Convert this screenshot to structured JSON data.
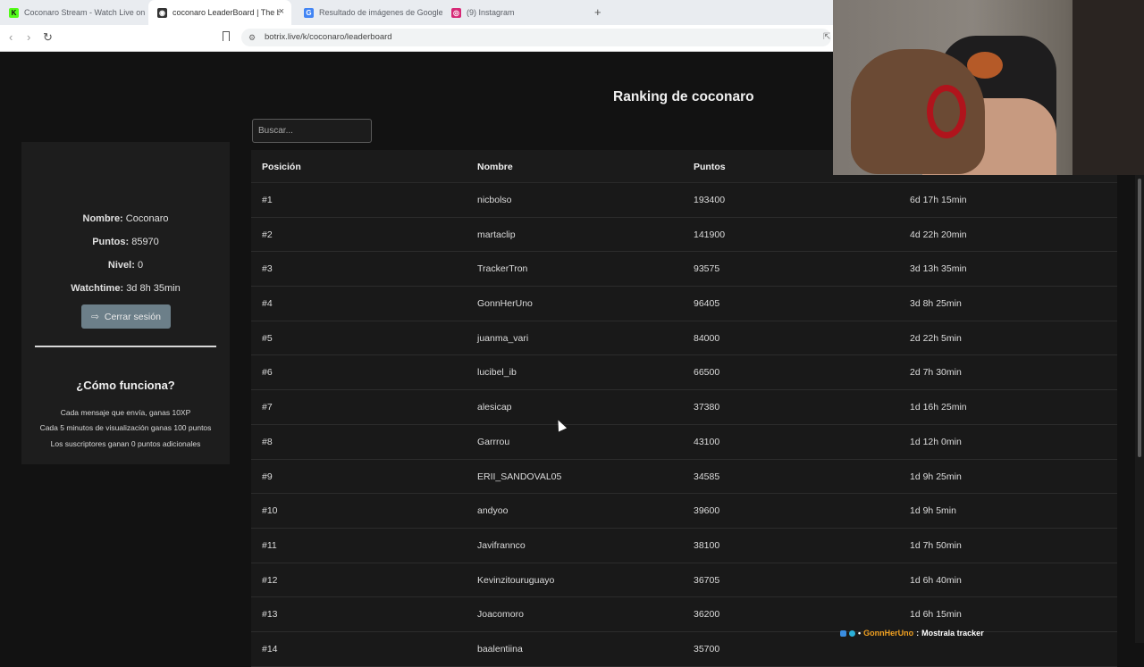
{
  "browser": {
    "tabs": [
      {
        "title": "Coconaro Stream - Watch Live on Ki",
        "favicon_color": "#53fc18",
        "favicon_glyph": "K"
      },
      {
        "title": "coconaro LeaderBoard | The bes",
        "favicon_color": "#333333",
        "favicon_glyph": "◉",
        "close": "×"
      },
      {
        "title": "Resultado de imágenes de Google",
        "favicon_color": "#4285f4",
        "favicon_glyph": "G"
      },
      {
        "title": "(9) Instagram",
        "favicon_color": "#d62976",
        "favicon_glyph": "◎"
      }
    ],
    "new_tab": "+",
    "url": "botrix.live/k/coconaro/leaderboard"
  },
  "page": {
    "title": "Ranking de coconaro",
    "search_placeholder": "Buscar..."
  },
  "profile": {
    "name_label": "Nombre:",
    "name_value": "Coconaro",
    "points_label": "Puntos:",
    "points_value": "85970",
    "level_label": "Nivel:",
    "level_value": "0",
    "watchtime_label": "Watchtime:",
    "watchtime_value": "3d 8h 35min",
    "logout_label": "Cerrar sesión"
  },
  "how": {
    "title": "¿Cómo funciona?",
    "lines": [
      "Cada mensaje que envía, ganas 10XP",
      "Cada 5 minutos de visualización ganas 100 puntos",
      "Los suscriptores ganan 0 puntos adicionales"
    ]
  },
  "table": {
    "headers": [
      "Posición",
      "Nombre",
      "Puntos"
    ],
    "rows": [
      {
        "pos": "#1",
        "name": "nicbolso",
        "points": "193400",
        "time": "6d 17h 15min"
      },
      {
        "pos": "#2",
        "name": "martaclip",
        "points": "141900",
        "time": "4d 22h 20min"
      },
      {
        "pos": "#3",
        "name": "TrackerTron",
        "points": "93575",
        "time": "3d 13h 35min"
      },
      {
        "pos": "#4",
        "name": "GonnHerUno",
        "points": "96405",
        "time": "3d 8h 25min"
      },
      {
        "pos": "#5",
        "name": "juanma_vari",
        "points": "84000",
        "time": "2d 22h 5min"
      },
      {
        "pos": "#6",
        "name": "lucibel_ib",
        "points": "66500",
        "time": "2d 7h 30min"
      },
      {
        "pos": "#7",
        "name": "alesicap",
        "points": "37380",
        "time": "1d 16h 25min"
      },
      {
        "pos": "#8",
        "name": "Garrrou",
        "points": "43100",
        "time": "1d 12h 0min"
      },
      {
        "pos": "#9",
        "name": "ERII_SANDOVAL05",
        "points": "34585",
        "time": "1d 9h 25min"
      },
      {
        "pos": "#10",
        "name": "andyoo",
        "points": "39600",
        "time": "1d 9h 5min"
      },
      {
        "pos": "#11",
        "name": "Javifrannco",
        "points": "38100",
        "time": "1d 7h 50min"
      },
      {
        "pos": "#12",
        "name": "Kevinzitouruguayo",
        "points": "36705",
        "time": "1d 6h 40min"
      },
      {
        "pos": "#13",
        "name": "Joacomoro",
        "points": "36200",
        "time": "1d 6h 15min"
      },
      {
        "pos": "#14",
        "name": "baalentiina",
        "points": "35700",
        "time": ""
      }
    ]
  },
  "overlay": {
    "tracker_user": "GonnHerUno",
    "tracker_sep": ":",
    "tracker_text": "Mostrala tracker"
  }
}
